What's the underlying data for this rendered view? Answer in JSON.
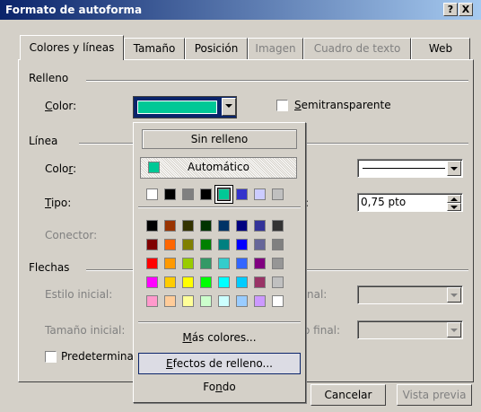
{
  "window": {
    "title": "Formato de autoforma",
    "help": "?",
    "close": "X"
  },
  "tabs": [
    {
      "label": "Colores y líneas",
      "state": "active"
    },
    {
      "label": "Tamaño",
      "state": "normal"
    },
    {
      "label": "Posición",
      "state": "normal"
    },
    {
      "label": "Imagen",
      "state": "disabled"
    },
    {
      "label": "Cuadro de texto",
      "state": "disabled"
    },
    {
      "label": "Web",
      "state": "normal"
    }
  ],
  "relleno": {
    "section": "Relleno",
    "color_label_key": "C",
    "color_label_rest": "olor:",
    "color_value": "#00c896",
    "semitransparent_key": "S",
    "semitransparent_rest": "emitransparente",
    "semitransparent_checked": false
  },
  "linea": {
    "section": "Línea",
    "color_label_pre": "Colo",
    "color_label_key": "r",
    "color_label_post": ":",
    "tipo_label_key": "T",
    "tipo_label_rest": "ipo:",
    "grosor_value": "0,75 pto",
    "conector_label": "Conector:"
  },
  "flechas": {
    "section": "Flechas",
    "estilo_inicial": "Estilo inicial:",
    "tamano_inicial": "Tamaño inicial:",
    "estilo_final_partial": "nal:",
    "tamano_final_partial": "o final:",
    "predeterminado_partial": "Predetermina",
    "predeterminado_checked": false
  },
  "buttons": {
    "cancel": "Cancelar",
    "preview": "Vista previa"
  },
  "popup": {
    "no_fill": "Sin relleno",
    "automatic": "Automático",
    "automatic_color": "#00c896",
    "more_colors_key": "M",
    "more_colors_rest": "ás colores...",
    "fill_effects_key": "E",
    "fill_effects_rest": "fectos de relleno...",
    "background_pre": "Fo",
    "background_key": "n",
    "background_post": "do",
    "recent_colors": [
      "#ffffff",
      "#000000",
      "#808080",
      "#000000",
      "#00c896",
      "#3333cc",
      "#ccccff",
      "#c0c0c0"
    ],
    "palette": [
      [
        "#000000",
        "#993300",
        "#333300",
        "#003300",
        "#003366",
        "#000080",
        "#333399",
        "#333333"
      ],
      [
        "#800000",
        "#ff6600",
        "#808000",
        "#008000",
        "#008080",
        "#0000ff",
        "#666699",
        "#808080"
      ],
      [
        "#ff0000",
        "#ff9900",
        "#99cc00",
        "#339966",
        "#33cccc",
        "#3366ff",
        "#800080",
        "#969696"
      ],
      [
        "#ff00ff",
        "#ffcc00",
        "#ffff00",
        "#00ff00",
        "#00ffff",
        "#00ccff",
        "#993366",
        "#c0c0c0"
      ],
      [
        "#ff99cc",
        "#ffcc99",
        "#ffff99",
        "#ccffcc",
        "#ccffff",
        "#99ccff",
        "#cc99ff",
        "#ffffff"
      ]
    ]
  }
}
